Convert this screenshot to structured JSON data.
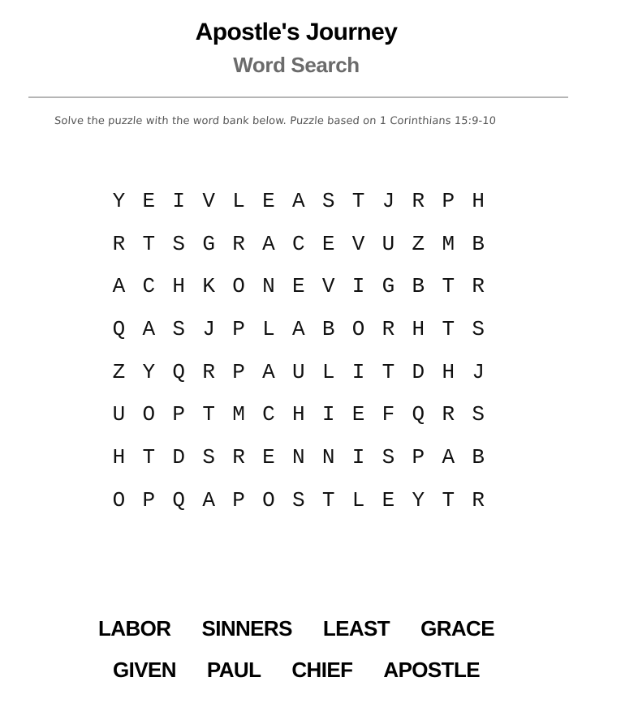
{
  "header": {
    "title": "Apostle's Journey",
    "subtitle": "Word Search"
  },
  "instructions": "Solve the puzzle with the word bank below. Puzzle based on 1 Corinthians 15:9-10",
  "grid": [
    [
      "Y",
      "E",
      "I",
      "V",
      "L",
      "E",
      "A",
      "S",
      "T",
      "J",
      "R",
      "P",
      "H"
    ],
    [
      "R",
      "T",
      "S",
      "G",
      "R",
      "A",
      "C",
      "E",
      "V",
      "U",
      "Z",
      "M",
      "B"
    ],
    [
      "A",
      "C",
      "H",
      "K",
      "O",
      "N",
      "E",
      "V",
      "I",
      "G",
      "B",
      "T",
      "R"
    ],
    [
      "Q",
      "A",
      "S",
      "J",
      "P",
      "L",
      "A",
      "B",
      "O",
      "R",
      "H",
      "T",
      "S"
    ],
    [
      "Z",
      "Y",
      "Q",
      "R",
      "P",
      "A",
      "U",
      "L",
      "I",
      "T",
      "D",
      "H",
      "J"
    ],
    [
      "U",
      "O",
      "P",
      "T",
      "M",
      "C",
      "H",
      "I",
      "E",
      "F",
      "Q",
      "R",
      "S"
    ],
    [
      "H",
      "T",
      "D",
      "S",
      "R",
      "E",
      "N",
      "N",
      "I",
      "S",
      "P",
      "A",
      "B"
    ],
    [
      "O",
      "P",
      "Q",
      "A",
      "P",
      "O",
      "S",
      "T",
      "L",
      "E",
      "Y",
      "T",
      "R"
    ]
  ],
  "word_bank": [
    [
      "LABOR",
      "SINNERS",
      "LEAST",
      "GRACE"
    ],
    [
      "GIVEN",
      "PAUL",
      "CHIEF",
      "APOSTLE"
    ]
  ]
}
